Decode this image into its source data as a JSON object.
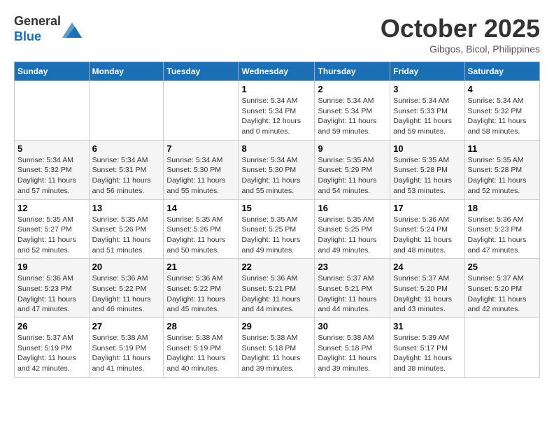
{
  "header": {
    "logo_text_general": "General",
    "logo_text_blue": "Blue",
    "month_title": "October 2025",
    "location": "Gibgos, Bicol, Philippines"
  },
  "days_of_week": [
    "Sunday",
    "Monday",
    "Tuesday",
    "Wednesday",
    "Thursday",
    "Friday",
    "Saturday"
  ],
  "weeks": [
    [
      {
        "day": "",
        "sunrise": "",
        "sunset": "",
        "daylight": ""
      },
      {
        "day": "",
        "sunrise": "",
        "sunset": "",
        "daylight": ""
      },
      {
        "day": "",
        "sunrise": "",
        "sunset": "",
        "daylight": ""
      },
      {
        "day": "1",
        "sunrise": "Sunrise: 5:34 AM",
        "sunset": "Sunset: 5:34 PM",
        "daylight": "Daylight: 12 hours and 0 minutes."
      },
      {
        "day": "2",
        "sunrise": "Sunrise: 5:34 AM",
        "sunset": "Sunset: 5:34 PM",
        "daylight": "Daylight: 11 hours and 59 minutes."
      },
      {
        "day": "3",
        "sunrise": "Sunrise: 5:34 AM",
        "sunset": "Sunset: 5:33 PM",
        "daylight": "Daylight: 11 hours and 59 minutes."
      },
      {
        "day": "4",
        "sunrise": "Sunrise: 5:34 AM",
        "sunset": "Sunset: 5:32 PM",
        "daylight": "Daylight: 11 hours and 58 minutes."
      }
    ],
    [
      {
        "day": "5",
        "sunrise": "Sunrise: 5:34 AM",
        "sunset": "Sunset: 5:32 PM",
        "daylight": "Daylight: 11 hours and 57 minutes."
      },
      {
        "day": "6",
        "sunrise": "Sunrise: 5:34 AM",
        "sunset": "Sunset: 5:31 PM",
        "daylight": "Daylight: 11 hours and 56 minutes."
      },
      {
        "day": "7",
        "sunrise": "Sunrise: 5:34 AM",
        "sunset": "Sunset: 5:30 PM",
        "daylight": "Daylight: 11 hours and 55 minutes."
      },
      {
        "day": "8",
        "sunrise": "Sunrise: 5:34 AM",
        "sunset": "Sunset: 5:30 PM",
        "daylight": "Daylight: 11 hours and 55 minutes."
      },
      {
        "day": "9",
        "sunrise": "Sunrise: 5:35 AM",
        "sunset": "Sunset: 5:29 PM",
        "daylight": "Daylight: 11 hours and 54 minutes."
      },
      {
        "day": "10",
        "sunrise": "Sunrise: 5:35 AM",
        "sunset": "Sunset: 5:28 PM",
        "daylight": "Daylight: 11 hours and 53 minutes."
      },
      {
        "day": "11",
        "sunrise": "Sunrise: 5:35 AM",
        "sunset": "Sunset: 5:28 PM",
        "daylight": "Daylight: 11 hours and 52 minutes."
      }
    ],
    [
      {
        "day": "12",
        "sunrise": "Sunrise: 5:35 AM",
        "sunset": "Sunset: 5:27 PM",
        "daylight": "Daylight: 11 hours and 52 minutes."
      },
      {
        "day": "13",
        "sunrise": "Sunrise: 5:35 AM",
        "sunset": "Sunset: 5:26 PM",
        "daylight": "Daylight: 11 hours and 51 minutes."
      },
      {
        "day": "14",
        "sunrise": "Sunrise: 5:35 AM",
        "sunset": "Sunset: 5:26 PM",
        "daylight": "Daylight: 11 hours and 50 minutes."
      },
      {
        "day": "15",
        "sunrise": "Sunrise: 5:35 AM",
        "sunset": "Sunset: 5:25 PM",
        "daylight": "Daylight: 11 hours and 49 minutes."
      },
      {
        "day": "16",
        "sunrise": "Sunrise: 5:35 AM",
        "sunset": "Sunset: 5:25 PM",
        "daylight": "Daylight: 11 hours and 49 minutes."
      },
      {
        "day": "17",
        "sunrise": "Sunrise: 5:36 AM",
        "sunset": "Sunset: 5:24 PM",
        "daylight": "Daylight: 11 hours and 48 minutes."
      },
      {
        "day": "18",
        "sunrise": "Sunrise: 5:36 AM",
        "sunset": "Sunset: 5:23 PM",
        "daylight": "Daylight: 11 hours and 47 minutes."
      }
    ],
    [
      {
        "day": "19",
        "sunrise": "Sunrise: 5:36 AM",
        "sunset": "Sunset: 5:23 PM",
        "daylight": "Daylight: 11 hours and 47 minutes."
      },
      {
        "day": "20",
        "sunrise": "Sunrise: 5:36 AM",
        "sunset": "Sunset: 5:22 PM",
        "daylight": "Daylight: 11 hours and 46 minutes."
      },
      {
        "day": "21",
        "sunrise": "Sunrise: 5:36 AM",
        "sunset": "Sunset: 5:22 PM",
        "daylight": "Daylight: 11 hours and 45 minutes."
      },
      {
        "day": "22",
        "sunrise": "Sunrise: 5:36 AM",
        "sunset": "Sunset: 5:21 PM",
        "daylight": "Daylight: 11 hours and 44 minutes."
      },
      {
        "day": "23",
        "sunrise": "Sunrise: 5:37 AM",
        "sunset": "Sunset: 5:21 PM",
        "daylight": "Daylight: 11 hours and 44 minutes."
      },
      {
        "day": "24",
        "sunrise": "Sunrise: 5:37 AM",
        "sunset": "Sunset: 5:20 PM",
        "daylight": "Daylight: 11 hours and 43 minutes."
      },
      {
        "day": "25",
        "sunrise": "Sunrise: 5:37 AM",
        "sunset": "Sunset: 5:20 PM",
        "daylight": "Daylight: 11 hours and 42 minutes."
      }
    ],
    [
      {
        "day": "26",
        "sunrise": "Sunrise: 5:37 AM",
        "sunset": "Sunset: 5:19 PM",
        "daylight": "Daylight: 11 hours and 42 minutes."
      },
      {
        "day": "27",
        "sunrise": "Sunrise: 5:38 AM",
        "sunset": "Sunset: 5:19 PM",
        "daylight": "Daylight: 11 hours and 41 minutes."
      },
      {
        "day": "28",
        "sunrise": "Sunrise: 5:38 AM",
        "sunset": "Sunset: 5:19 PM",
        "daylight": "Daylight: 11 hours and 40 minutes."
      },
      {
        "day": "29",
        "sunrise": "Sunrise: 5:38 AM",
        "sunset": "Sunset: 5:18 PM",
        "daylight": "Daylight: 11 hours and 39 minutes."
      },
      {
        "day": "30",
        "sunrise": "Sunrise: 5:38 AM",
        "sunset": "Sunset: 5:18 PM",
        "daylight": "Daylight: 11 hours and 39 minutes."
      },
      {
        "day": "31",
        "sunrise": "Sunrise: 5:39 AM",
        "sunset": "Sunset: 5:17 PM",
        "daylight": "Daylight: 11 hours and 38 minutes."
      },
      {
        "day": "",
        "sunrise": "",
        "sunset": "",
        "daylight": ""
      }
    ]
  ]
}
